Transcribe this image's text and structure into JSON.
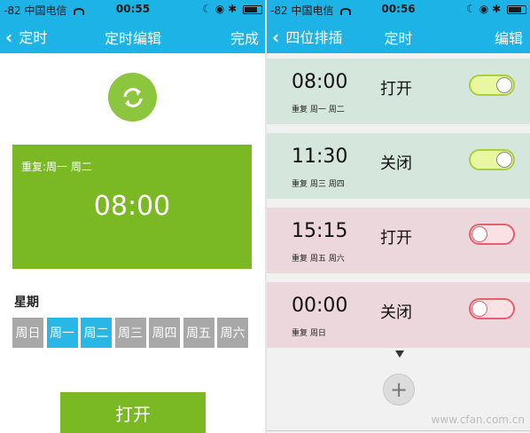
{
  "colors": {
    "nav_blue": "#1eb3e6",
    "green": "#7ab924",
    "day_selected": "#29b7e8",
    "day_unselected": "#a8a8a8",
    "row_on_bg": "#d5e6dc",
    "row_off_bg": "#ecd7dc",
    "toggle_on": "#a8d03c",
    "toggle_off": "#e65f6d"
  },
  "left": {
    "status": {
      "signal": "-82",
      "carrier": "中国电信",
      "time": "00:55"
    },
    "nav": {
      "back_label": "定时",
      "title": "定时编辑",
      "done_label": "完成"
    },
    "sync_icon": "refresh-icon",
    "panel": {
      "repeat_text": "重复:周一 周二",
      "time": "08:00"
    },
    "week_label": "星期",
    "days": [
      {
        "label": "周日",
        "selected": false
      },
      {
        "label": "周一",
        "selected": true
      },
      {
        "label": "周二",
        "selected": true
      },
      {
        "label": "周三",
        "selected": false
      },
      {
        "label": "周四",
        "selected": false
      },
      {
        "label": "周五",
        "selected": false
      },
      {
        "label": "周六",
        "selected": false
      }
    ],
    "action_button": "打开"
  },
  "right": {
    "status": {
      "signal": "-82",
      "carrier": "中国电信",
      "time": "00:56"
    },
    "nav": {
      "back_label": "四位排插",
      "title": "定时",
      "edit_label": "编辑"
    },
    "timers": [
      {
        "time": "08:00",
        "action": "打开",
        "repeat": "重复 周一 周二",
        "enabled": true
      },
      {
        "time": "11:30",
        "action": "关闭",
        "repeat": "重复 周三 周四",
        "enabled": true
      },
      {
        "time": "15:15",
        "action": "打开",
        "repeat": "重复 周五 周六",
        "enabled": false
      },
      {
        "time": "00:00",
        "action": "关闭",
        "repeat": "重复 周日",
        "enabled": false
      }
    ],
    "add_icon": "plus-icon",
    "watermark": "www.cfan.com.cn"
  }
}
